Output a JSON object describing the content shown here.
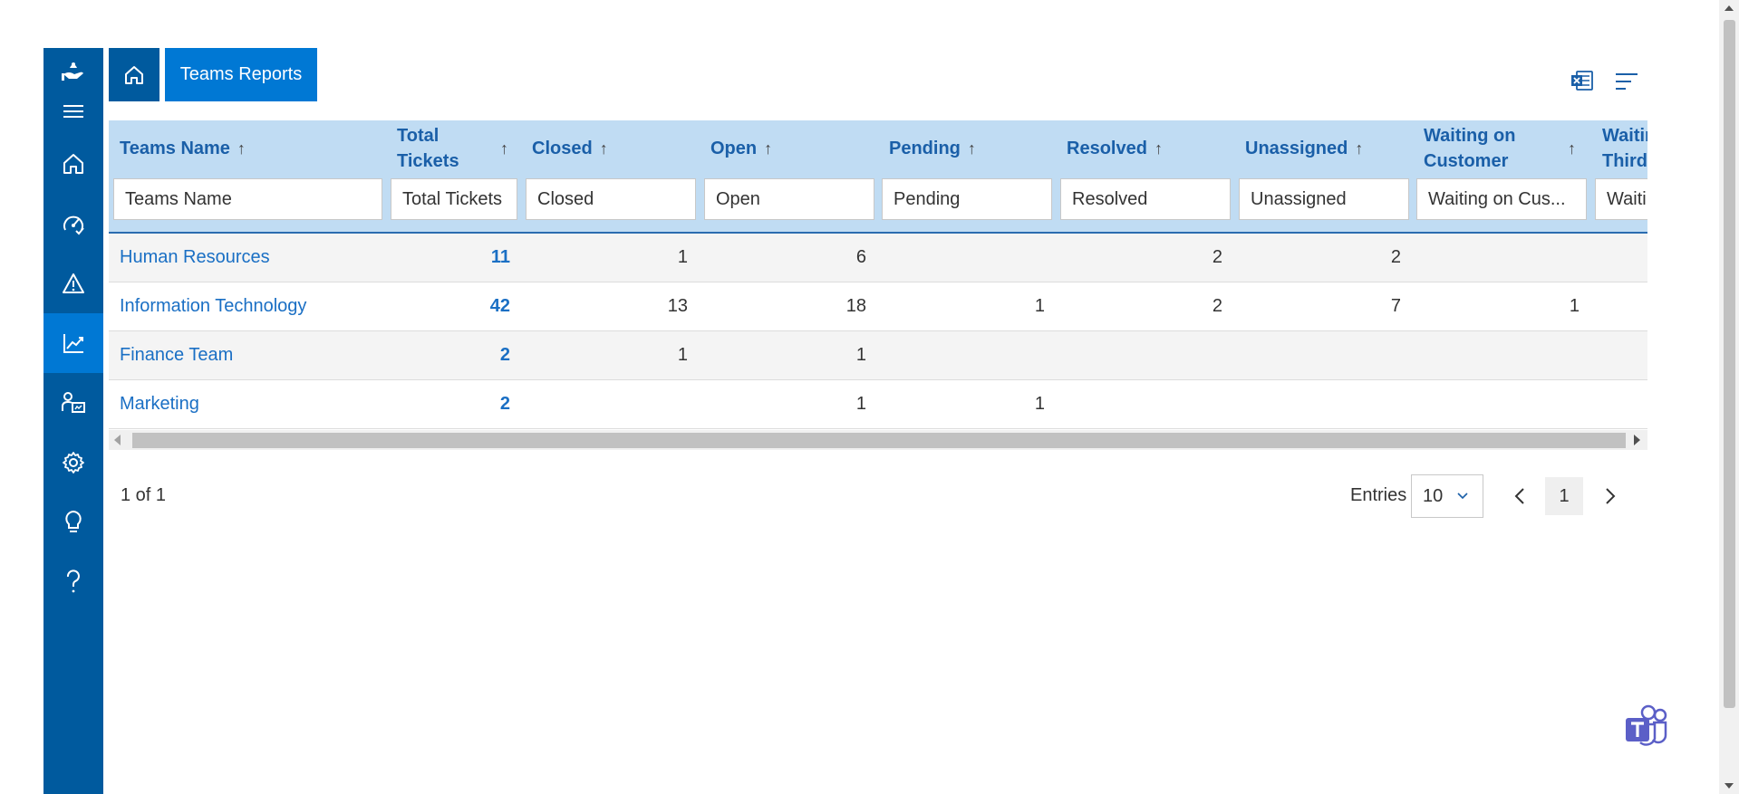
{
  "sidebar": {
    "logo_icon": "hand-bell-icon",
    "menu_icon": "hamburger-icon",
    "items": [
      {
        "key": "home",
        "icon": "home-icon"
      },
      {
        "key": "dashboard",
        "icon": "speedometer-icon"
      },
      {
        "key": "alerts",
        "icon": "warning-icon"
      },
      {
        "key": "reports",
        "icon": "chart-line-icon",
        "active": true
      },
      {
        "key": "users",
        "icon": "users-icon"
      },
      {
        "key": "settings",
        "icon": "gear-icon"
      },
      {
        "key": "ideas",
        "icon": "lightbulb-icon"
      },
      {
        "key": "help",
        "icon": "question-icon"
      }
    ],
    "bg_color": "#005a9e",
    "active_color": "#0078d4"
  },
  "breadcrumb": {
    "home_icon": "home-icon",
    "title": "Teams Reports"
  },
  "toolbar": {
    "excel_icon": "excel-export-icon",
    "filter_icon": "filter-lines-icon"
  },
  "table": {
    "columns": [
      {
        "label": "Teams Name",
        "placeholder": "Teams Name"
      },
      {
        "label": "Total Tickets",
        "placeholder": "Total Tickets"
      },
      {
        "label": "Closed",
        "placeholder": "Closed"
      },
      {
        "label": "Open",
        "placeholder": "Open"
      },
      {
        "label": "Pending",
        "placeholder": "Pending"
      },
      {
        "label": "Resolved",
        "placeholder": "Resolved"
      },
      {
        "label": "Unassigned",
        "placeholder": "Unassigned"
      },
      {
        "label": "Waiting on Customer",
        "placeholder": "Waiting on Cus..."
      },
      {
        "label": "Waiting on Third",
        "placeholder": "Waiti"
      }
    ],
    "rows": [
      {
        "name": "Human Resources",
        "total": "11",
        "closed": "1",
        "open": "6",
        "pending": "",
        "resolved": "2",
        "unassigned": "2",
        "waiting_customer": ""
      },
      {
        "name": "Information Technology",
        "total": "42",
        "closed": "13",
        "open": "18",
        "pending": "1",
        "resolved": "2",
        "unassigned": "7",
        "waiting_customer": "1"
      },
      {
        "name": "Finance Team",
        "total": "2",
        "closed": "1",
        "open": "1",
        "pending": "",
        "resolved": "",
        "unassigned": "",
        "waiting_customer": ""
      },
      {
        "name": "Marketing",
        "total": "2",
        "closed": "",
        "open": "1",
        "pending": "1",
        "resolved": "",
        "unassigned": "",
        "waiting_customer": ""
      }
    ],
    "header_bg": "#c0dcf3",
    "link_color": "#1a6fc4"
  },
  "footer": {
    "page_count": "1 of 1",
    "entries_label": "Entries",
    "entries_value": "10",
    "current_page": "1"
  },
  "widget": {
    "teams_icon": "microsoft-teams-icon"
  }
}
